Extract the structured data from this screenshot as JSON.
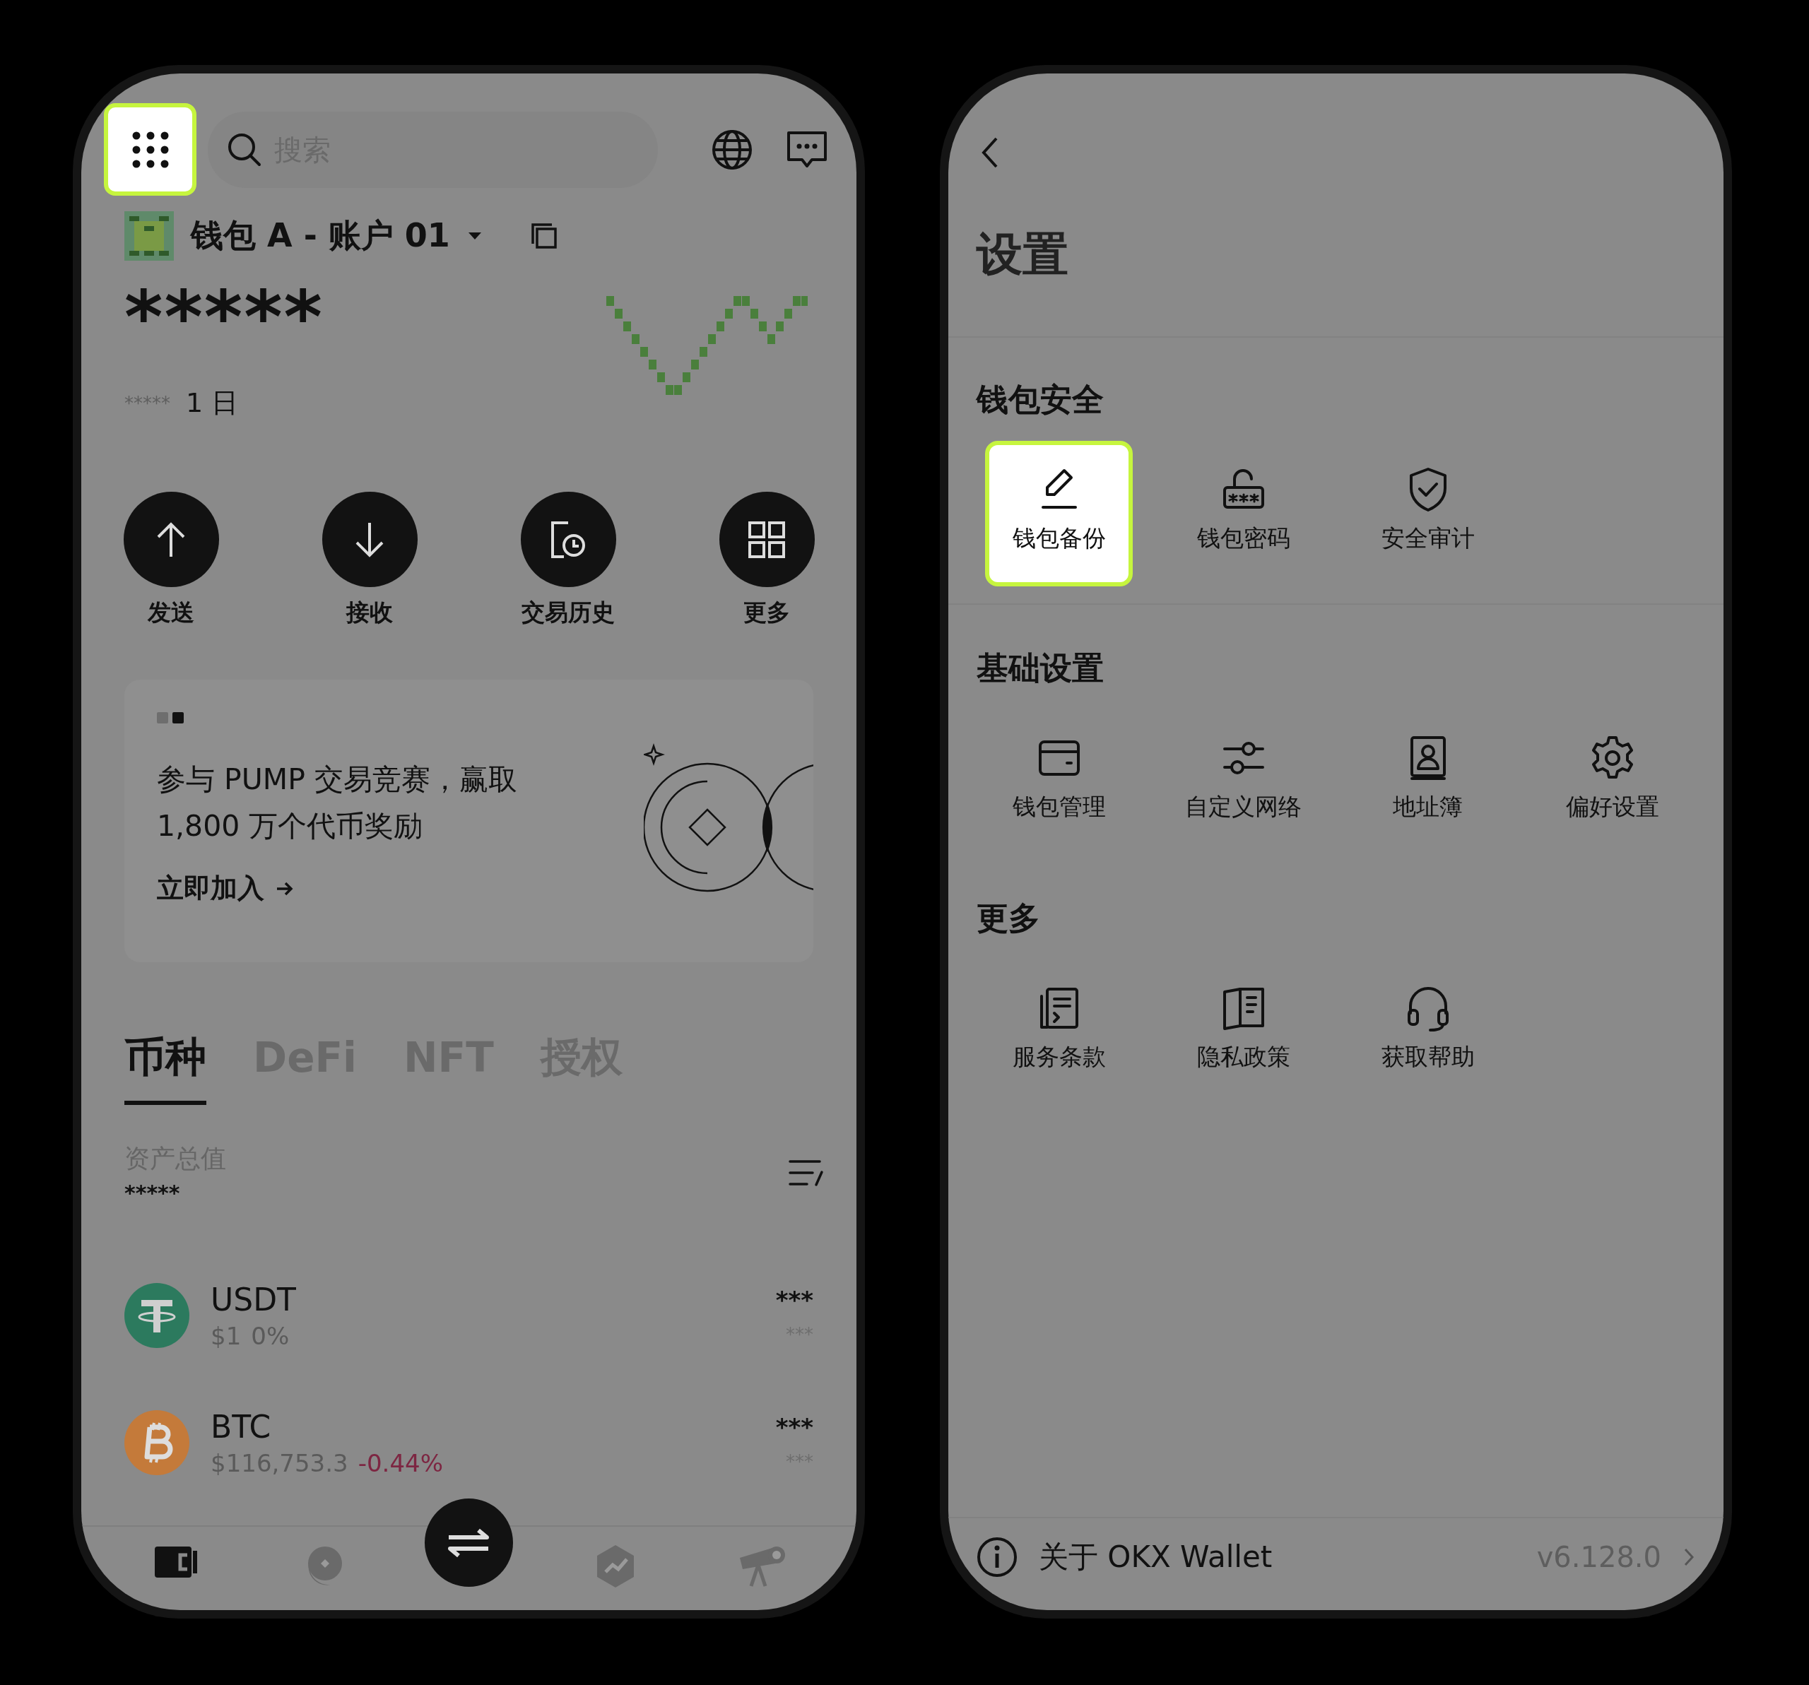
{
  "home": {
    "top_bar": {
      "menu_highlighted": true,
      "search": {
        "placeholder": "搜索"
      }
    },
    "account": {
      "name": "钱包 A - 账户 01"
    },
    "balance": "*****",
    "change": {
      "value": "*****",
      "period": "1 日"
    },
    "actions": [
      {
        "label": "发送",
        "kind": "send"
      },
      {
        "label": "接收",
        "kind": "receive"
      },
      {
        "label": "交易历史",
        "kind": "history"
      },
      {
        "label": "更多",
        "kind": "more"
      }
    ],
    "promo": {
      "pages": [
        {
          "selected": false
        },
        {
          "selected": true
        }
      ],
      "text": "参与 PUMP 交易竞赛，赢取1,800 万个代币奖励",
      "link": "立即加入"
    },
    "tabs": [
      {
        "label": "币种",
        "selected": true
      },
      {
        "label": "DeFi",
        "selected": false
      },
      {
        "label": "NFT",
        "selected": false
      },
      {
        "label": "授权",
        "selected": false
      }
    ],
    "total": {
      "label": "资产总值",
      "value": "*****"
    },
    "assets": [
      {
        "symbol": "USDT",
        "kind": "usdt",
        "price": "$1",
        "change": "0%",
        "color": "#5a5a5a",
        "amount": "***",
        "value": "***"
      },
      {
        "symbol": "BTC",
        "kind": "btc",
        "price": "$116,753.3",
        "change": "-0.44%",
        "color": "#7d2642",
        "amount": "***",
        "value": "***"
      }
    ],
    "nav": [
      {
        "kind": "wallet",
        "selected": true
      },
      {
        "kind": "market",
        "selected": false
      },
      {
        "kind": "dex",
        "selected": false
      },
      {
        "kind": "defi",
        "selected": false
      },
      {
        "kind": "discover",
        "selected": false
      }
    ]
  },
  "settings": {
    "title": "设置",
    "sections": [
      {
        "title": "钱包安全",
        "items": [
          {
            "label": "钱包备份",
            "kind": "backup",
            "highlighted": true
          },
          {
            "label": "钱包密码",
            "kind": "password",
            "highlighted": false
          },
          {
            "label": "安全审计",
            "kind": "audit",
            "highlighted": false
          }
        ]
      },
      {
        "title": "基础设置",
        "items": [
          {
            "label": "钱包管理",
            "kind": "wallet",
            "highlighted": false
          },
          {
            "label": "自定义网络",
            "kind": "network",
            "highlighted": false
          },
          {
            "label": "地址簿",
            "kind": "contacts",
            "highlighted": false
          },
          {
            "label": "偏好设置",
            "kind": "gear",
            "highlighted": false
          }
        ]
      },
      {
        "title": "更多",
        "items": [
          {
            "label": "服务条款",
            "kind": "terms",
            "highlighted": false
          },
          {
            "label": "隐私政策",
            "kind": "privacy",
            "highlighted": false
          },
          {
            "label": "获取帮助",
            "kind": "help",
            "highlighted": false
          }
        ]
      }
    ],
    "about": {
      "label": "关于 OKX Wallet",
      "version": "v6.128.0"
    }
  }
}
